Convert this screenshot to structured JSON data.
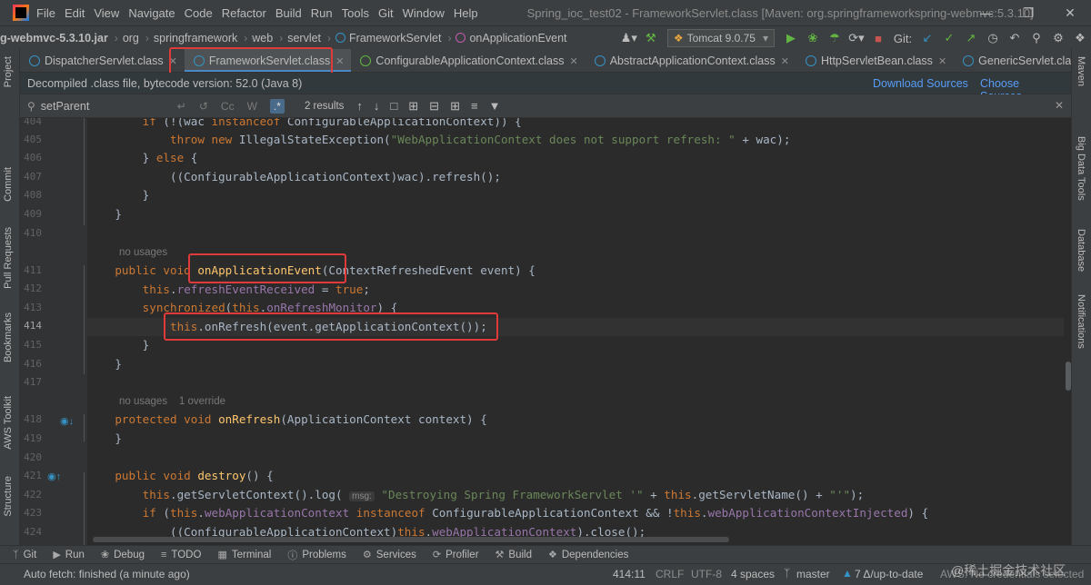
{
  "menubar": {
    "items": [
      "File",
      "Edit",
      "View",
      "Navigate",
      "Code",
      "Refactor",
      "Build",
      "Run",
      "Tools",
      "Git",
      "Window",
      "Help"
    ],
    "window_title": "Spring_ioc_test02 - FrameworkServlet.class [Maven: org.springframeworkspring-webmvc:5.3.10]"
  },
  "breadcrumb": {
    "jar": "g-webmvc-5.3.10.jar",
    "parts": [
      "org",
      "springframework",
      "web",
      "servlet"
    ],
    "class": "FrameworkServlet",
    "method": "onApplicationEvent"
  },
  "toolbar": {
    "run_config": "Tomcat 9.0.75",
    "git_label": "Git:"
  },
  "tabs": [
    {
      "label": "DispatcherServlet.class",
      "icon": "class-icon",
      "active": false
    },
    {
      "label": "FrameworkServlet.class",
      "icon": "class-icon",
      "active": true
    },
    {
      "label": "ConfigurableApplicationContext.class",
      "icon": "interface-icon",
      "active": false
    },
    {
      "label": "AbstractApplicationContext.class",
      "icon": "class-icon",
      "active": false
    },
    {
      "label": "HttpServletBean.class",
      "icon": "class-icon",
      "active": false
    },
    {
      "label": "GenericServlet.class",
      "icon": "class-icon",
      "active": false
    }
  ],
  "banner": {
    "message": "Decompiled .class file, bytecode version: 52.0 (Java 8)",
    "download_sources": "Download Sources",
    "choose_sources": "Choose Sources..."
  },
  "search": {
    "value": "setParent",
    "results": "2 results",
    "cc_label": "Cc",
    "w_label": "W",
    "regex_label": ".*"
  },
  "code": {
    "line_numbers": [
      "404",
      "405",
      "406",
      "407",
      "408",
      "409",
      "410",
      "",
      "411",
      "412",
      "413",
      "414",
      "415",
      "416",
      "417",
      "",
      "418",
      "419",
      "420",
      "421",
      "422",
      "423",
      "424"
    ],
    "hints": {
      "no_usages_1": "no usages",
      "no_usages_2": "no usages",
      "override": "1 override",
      "msg_marker": "msg:"
    }
  },
  "left_tools": [
    "Project",
    "Commit",
    "Pull Requests",
    "Bookmarks",
    "AWS Toolkit",
    "Structure"
  ],
  "right_tools": [
    "Maven",
    "Big Data Tools",
    "Database",
    "Notifications"
  ],
  "bottom_tabs": [
    "Git",
    "Run",
    "Debug",
    "TODO",
    "Terminal",
    "Problems",
    "Services",
    "Profiler",
    "Build",
    "Dependencies"
  ],
  "status": {
    "message": "Auto fetch: finished (a minute ago)",
    "position": "414:11",
    "line_sep": "CRLF",
    "encoding": "UTF-8",
    "indent": "4 spaces",
    "branch": "master",
    "vcs": "7 Δ/up-to-date",
    "extra": "AWS: No credentials selected"
  },
  "watermark": "@稀土掘金技术社区",
  "colors": {
    "keyword": "#cc7832",
    "field": "#9876aa",
    "string": "#6a8759",
    "method_decl": "#ffc66d",
    "highlight_box": "#e03a3a",
    "active_tab_underline": "#4a88c7"
  }
}
